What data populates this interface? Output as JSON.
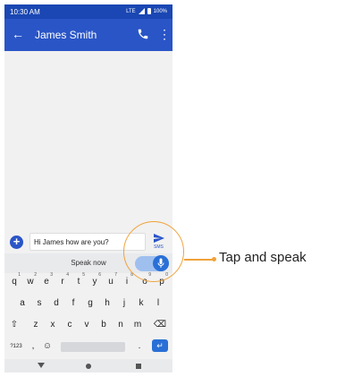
{
  "status_bar": {
    "time": "10:30 AM",
    "network": "LTE",
    "battery": "100%"
  },
  "app_bar": {
    "contact_name": "James Smith",
    "back_icon": "arrow-left-icon",
    "call_icon": "phone-icon",
    "more_icon": "more-vert-icon"
  },
  "compose": {
    "message": "Hi James how are you?",
    "send_label": "SMS",
    "add_icon": "plus-icon"
  },
  "voice": {
    "prompt": "Speak now",
    "mic_icon": "mic-icon"
  },
  "keyboard": {
    "row1": [
      {
        "key": "q",
        "hint": "1"
      },
      {
        "key": "w",
        "hint": "2"
      },
      {
        "key": "e",
        "hint": "3"
      },
      {
        "key": "r",
        "hint": "4"
      },
      {
        "key": "t",
        "hint": "5"
      },
      {
        "key": "y",
        "hint": "6"
      },
      {
        "key": "u",
        "hint": "7"
      },
      {
        "key": "i",
        "hint": "8"
      },
      {
        "key": "o",
        "hint": "9"
      },
      {
        "key": "p",
        "hint": "0"
      }
    ],
    "row2": [
      "a",
      "s",
      "d",
      "f",
      "g",
      "h",
      "j",
      "k",
      "l"
    ],
    "row3": [
      "z",
      "x",
      "c",
      "v",
      "b",
      "n",
      "m"
    ],
    "shift_icon": "shift-icon",
    "backspace_icon": "backspace-icon",
    "symbols": "?123",
    "comma": ",",
    "period": ".",
    "emoji_icon": "emoji-icon",
    "enter_icon": "enter-icon"
  },
  "callout": {
    "label": "Tap and speak"
  },
  "colors": {
    "accent": "#2a55c7",
    "status_bar": "#1a47b3",
    "callout": "#f0a23a"
  }
}
